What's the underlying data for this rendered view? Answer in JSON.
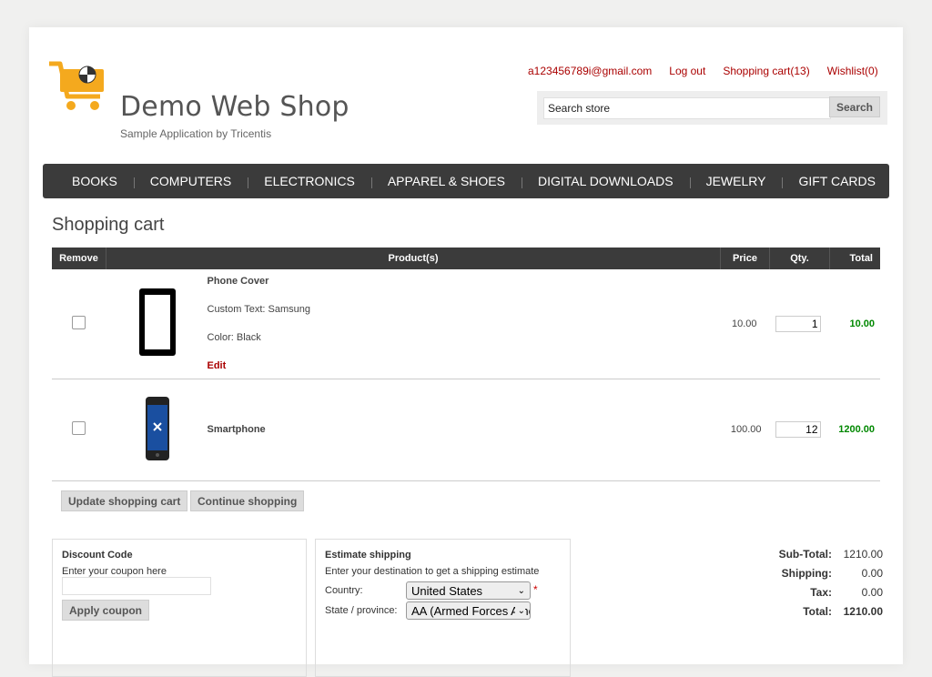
{
  "header": {
    "logo_title": "Demo Web Shop",
    "logo_subtitle": "Sample Application by Tricentis",
    "links": [
      "a123456789i@gmail.com",
      "Log out",
      "Shopping cart(13)",
      "Wishlist(0)"
    ],
    "search_placeholder": "Search store",
    "search_label": "Search"
  },
  "menu": [
    "BOOKS",
    "COMPUTERS",
    "ELECTRONICS",
    "APPAREL & SHOES",
    "DIGITAL DOWNLOADS",
    "JEWELRY",
    "GIFT CARDS"
  ],
  "page_title": "Shopping cart",
  "table": {
    "headers": [
      "Remove",
      "Product(s)",
      "Price",
      "Qty.",
      "Total"
    ],
    "rows": [
      {
        "name": "Phone Cover",
        "attr1": "Custom Text: Samsung",
        "attr2": "Color: Black",
        "edit": "Edit",
        "price": "10.00",
        "qty": "1",
        "total": "10.00"
      },
      {
        "name": "Smartphone",
        "price": "100.00",
        "qty": "12",
        "total": "1200.00"
      }
    ]
  },
  "buttons": {
    "update": "Update shopping cart",
    "continue": "Continue shopping",
    "apply": "Apply coupon"
  },
  "discount": {
    "title": "Discount Code",
    "text": "Enter your coupon here"
  },
  "shipping": {
    "title": "Estimate shipping",
    "text": "Enter your destination to get a shipping estimate",
    "country_label": "Country:",
    "country_value": "United States",
    "state_label": "State / province:",
    "state_value": "AA (Armed Forces Americas)",
    "required": "*"
  },
  "totals": {
    "subtotal_label": "Sub-Total:",
    "subtotal": "1210.00",
    "shipping_label": "Shipping:",
    "shipping": "0.00",
    "tax_label": "Tax:",
    "tax": "0.00",
    "total_label": "Total:",
    "total": "1210.00"
  },
  "colors": {
    "accent": "#aa0000",
    "menu_bg": "#3b3b3b",
    "total_green": "#008800",
    "logo_orange": "#f4a91e"
  }
}
